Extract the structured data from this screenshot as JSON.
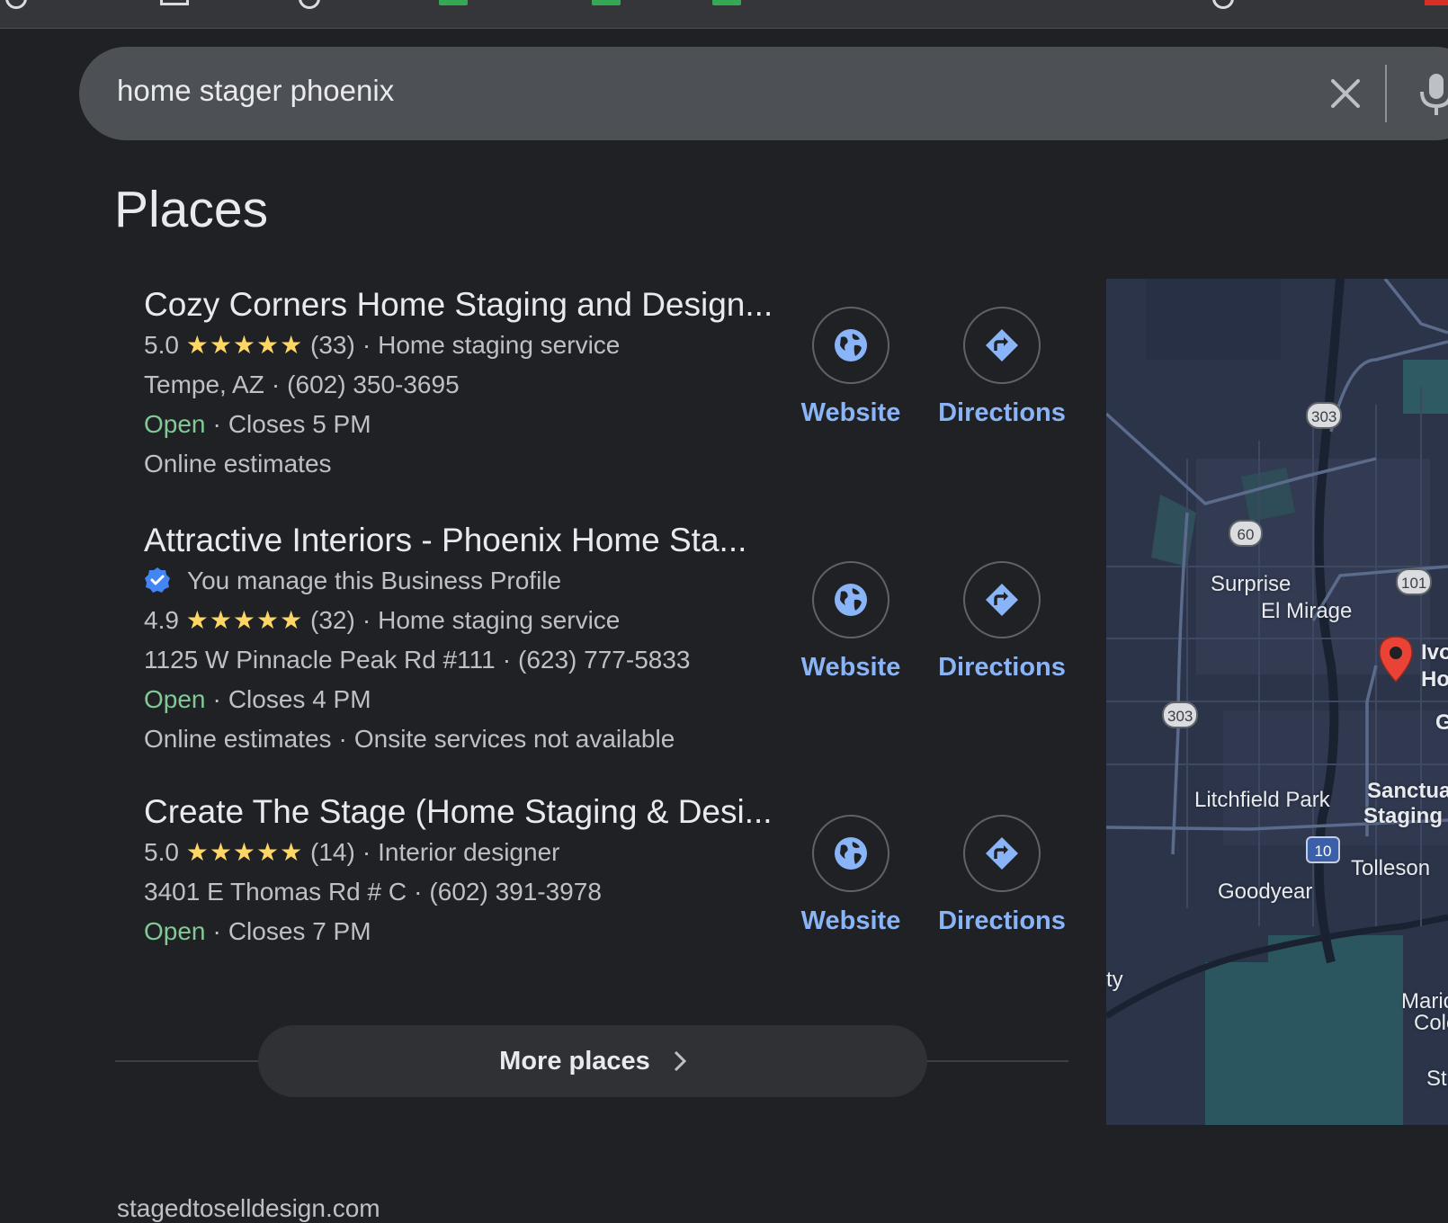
{
  "search": {
    "query": "home stager phoenix"
  },
  "section_title": "Places",
  "places": [
    {
      "name": "Cozy Corners Home Staging and Design...",
      "rating": "5.0",
      "stars": "★★★★★",
      "reviews": "(33)",
      "category": "Home staging service",
      "location": "Tempe, AZ",
      "phone": "(602) 350-3695",
      "status": "Open",
      "hours": "Closes 5 PM",
      "extra": "Online estimates"
    },
    {
      "name": "Attractive Interiors - Phoenix Home Sta...",
      "verified_text": "You manage this Business Profile",
      "rating": "4.9",
      "stars": "★★★★★",
      "reviews": "(32)",
      "category": "Home staging service",
      "location": "1125 W Pinnacle Peak Rd #111",
      "phone": "(623) 777-5833",
      "status": "Open",
      "hours": "Closes 4 PM",
      "extra": "Online estimates",
      "extra2": "Onsite services not available"
    },
    {
      "name": "Create The Stage (Home Staging & Desi...",
      "rating": "5.0",
      "stars": "★★★★★",
      "reviews": "(14)",
      "category": "Interior designer",
      "location": "3401 E Thomas Rd # C",
      "phone": "(602) 391-3978",
      "status": "Open",
      "hours": "Closes 7 PM"
    }
  ],
  "actions": {
    "website": "Website",
    "directions": "Directions"
  },
  "more_places": "More places",
  "map": {
    "labels": {
      "surprise": "Surprise",
      "el_mirage": "El Mirage",
      "litchfield": "Litchfield Park",
      "goodyear": "Goodyear",
      "tolleson": "Tolleson",
      "sanctuary": "Sanctua",
      "staging": "Staging",
      "ivo": "Ivo",
      "ho": "Ho",
      "g": "G",
      "ty": "ty",
      "mari": "Maric",
      "colo": "Colo",
      "st": "St."
    },
    "routes": {
      "r303a": "303",
      "r303b": "303",
      "r60": "60",
      "r101": "101",
      "r10": "10"
    }
  },
  "bottom_text": "stagedtoselldesign.com",
  "colors": {
    "background": "#202124",
    "link": "#8ab4f8",
    "open": "#81c995",
    "stars": "#fdd663",
    "pin": "#ea4335"
  }
}
